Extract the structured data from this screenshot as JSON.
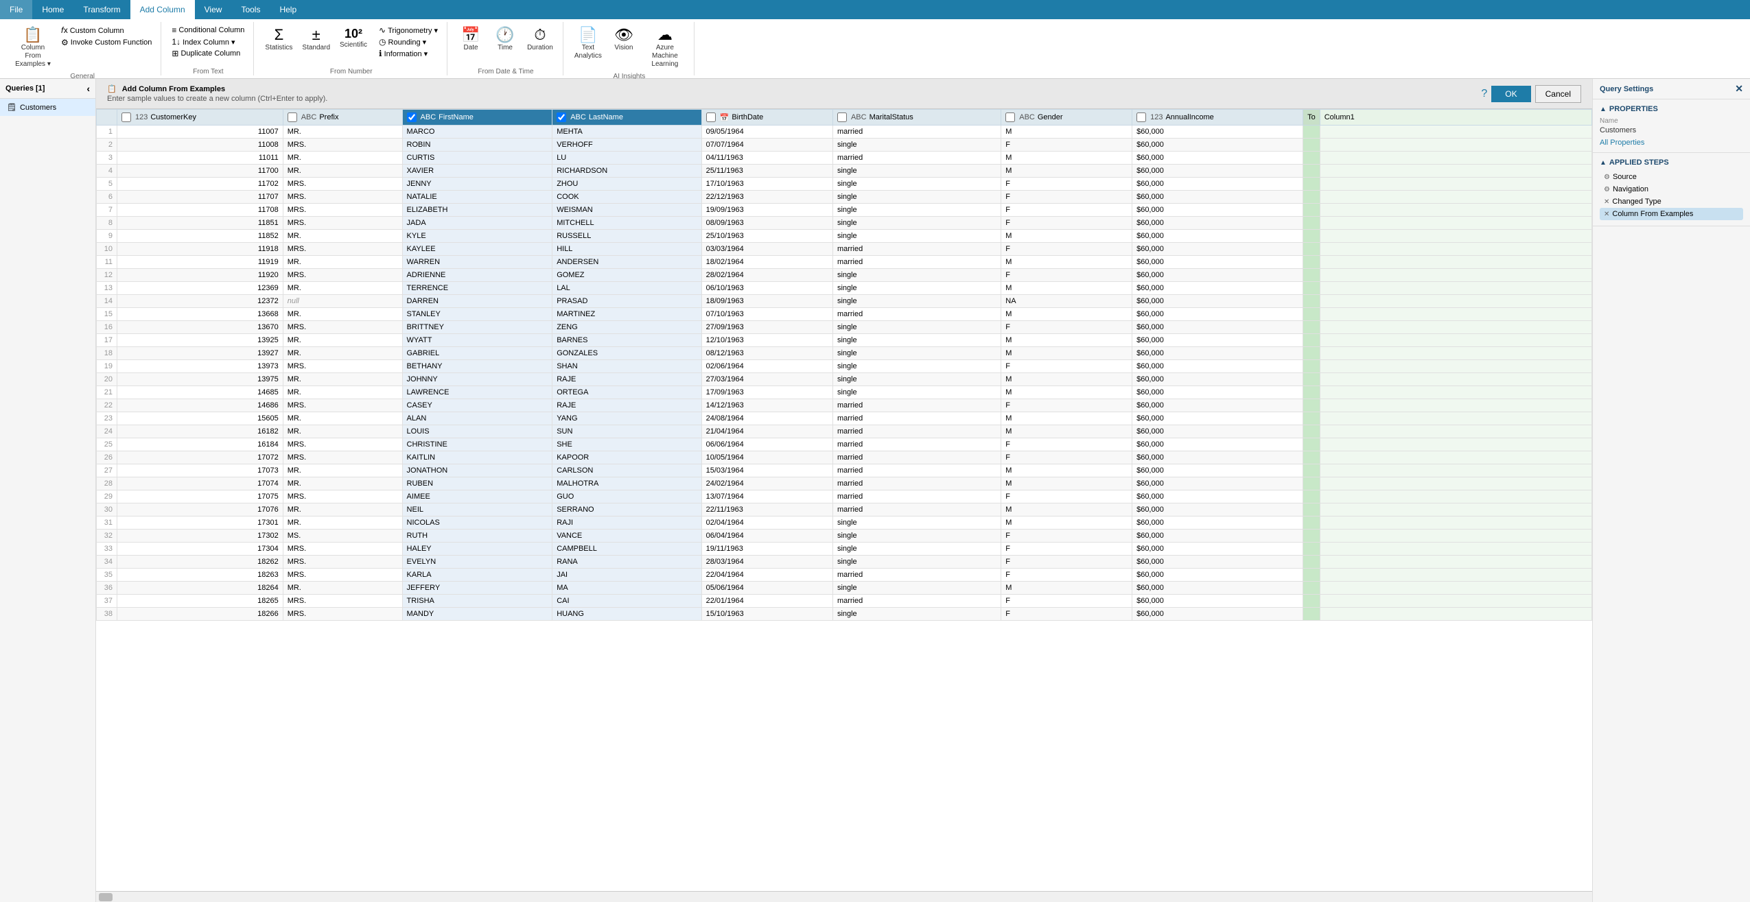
{
  "ribbon": {
    "tabs": [
      "File",
      "Home",
      "Transform",
      "Add Column",
      "View",
      "Tools",
      "Help"
    ],
    "active_tab": "Add Column",
    "groups": {
      "general": {
        "label": "General",
        "buttons": [
          {
            "id": "column-from-examples",
            "icon": "📋",
            "label": "Column From\nExamples ▾"
          },
          {
            "id": "custom-column",
            "icon": "fx",
            "label": "Custom\nColumn"
          },
          {
            "id": "invoke-custom-function",
            "icon": "⚙",
            "label": "Invoke Custom\nFunction"
          }
        ]
      },
      "from_text": {
        "label": "From Text",
        "items": [
          {
            "id": "conditional-column",
            "icon": "≡",
            "label": "Conditional Column"
          },
          {
            "id": "index-column",
            "icon": "1↓",
            "label": "Index Column ▾"
          },
          {
            "id": "duplicate-column",
            "icon": "⊞",
            "label": "Duplicate Column"
          }
        ]
      },
      "from_number": {
        "label": "From Number",
        "buttons": [
          {
            "id": "statistics",
            "icon": "Σ",
            "label": "Statistics"
          },
          {
            "id": "standard",
            "icon": "±",
            "label": "Standard"
          },
          {
            "id": "scientific",
            "icon": "10²",
            "label": "Scientific"
          },
          {
            "id": "trigonometry",
            "icon": "sin",
            "label": "Trigonometry ▾"
          },
          {
            "id": "rounding",
            "icon": "◷",
            "label": "Rounding ▾"
          },
          {
            "id": "information",
            "icon": "ℹ",
            "label": "Information ▾"
          }
        ]
      },
      "from_date_time": {
        "label": "From Date & Time",
        "buttons": [
          {
            "id": "date",
            "icon": "📅",
            "label": "Date"
          },
          {
            "id": "time",
            "icon": "🕐",
            "label": "Time"
          },
          {
            "id": "duration",
            "icon": "⏱",
            "label": "Duration"
          }
        ]
      },
      "text_analytics": {
        "label": "AI Insights",
        "buttons": [
          {
            "id": "text-analytics",
            "icon": "≡≡",
            "label": "Text\nAnalytics"
          },
          {
            "id": "vision",
            "icon": "👁",
            "label": "Vision"
          },
          {
            "id": "azure-ml",
            "icon": "☁",
            "label": "Azure Machine\nLearning"
          }
        ]
      }
    }
  },
  "left_panel": {
    "title": "Queries [1]",
    "queries": [
      {
        "id": "customers",
        "label": "Customers",
        "active": true
      }
    ]
  },
  "examples_bar": {
    "title": "Add Column From Examples",
    "subtitle": "Enter sample values to create a new column (Ctrl+Enter to apply).",
    "ok_label": "OK",
    "cancel_label": "Cancel"
  },
  "table": {
    "columns": [
      {
        "id": "row-num",
        "label": "",
        "type": "row-num",
        "selected": false
      },
      {
        "id": "customer-key",
        "label": "CustomerKey",
        "type": "123",
        "selected": false
      },
      {
        "id": "prefix",
        "label": "Prefix",
        "type": "ABC",
        "selected": false
      },
      {
        "id": "first-name",
        "label": "FirstName",
        "type": "ABC",
        "selected": true
      },
      {
        "id": "last-name",
        "label": "LastName",
        "type": "ABC",
        "selected": true
      },
      {
        "id": "birth-date",
        "label": "BirthDate",
        "type": "📅",
        "selected": false
      },
      {
        "id": "marital-status",
        "label": "MaritalStatus",
        "type": "ABC",
        "selected": false
      },
      {
        "id": "gender",
        "label": "Gender",
        "type": "ABC",
        "selected": false
      },
      {
        "id": "annual-income",
        "label": "AnnualIncome",
        "type": "123",
        "selected": false
      },
      {
        "id": "to-col",
        "label": "To",
        "type": "",
        "selected": false
      },
      {
        "id": "column1",
        "label": "Column1",
        "type": "",
        "selected": false
      }
    ],
    "rows": [
      {
        "row": 1,
        "customerKey": "11007",
        "prefix": "MR.",
        "firstName": "MARCO",
        "lastName": "MEHTA",
        "birthDate": "09/05/1964",
        "maritalStatus": "married",
        "gender": "M",
        "annualIncome": "$60,000",
        "to": "",
        "column1": ""
      },
      {
        "row": 2,
        "customerKey": "11008",
        "prefix": "MRS.",
        "firstName": "ROBIN",
        "lastName": "VERHOFF",
        "birthDate": "07/07/1964",
        "maritalStatus": "single",
        "gender": "F",
        "annualIncome": "$60,000",
        "to": "",
        "column1": ""
      },
      {
        "row": 3,
        "customerKey": "11011",
        "prefix": "MR.",
        "firstName": "CURTIS",
        "lastName": "LU",
        "birthDate": "04/11/1963",
        "maritalStatus": "married",
        "gender": "M",
        "annualIncome": "$60,000",
        "to": "",
        "column1": ""
      },
      {
        "row": 4,
        "customerKey": "11700",
        "prefix": "MR.",
        "firstName": "XAVIER",
        "lastName": "RICHARDSON",
        "birthDate": "25/11/1963",
        "maritalStatus": "single",
        "gender": "M",
        "annualIncome": "$60,000",
        "to": "",
        "column1": ""
      },
      {
        "row": 5,
        "customerKey": "11702",
        "prefix": "MRS.",
        "firstName": "JENNY",
        "lastName": "ZHOU",
        "birthDate": "17/10/1963",
        "maritalStatus": "single",
        "gender": "F",
        "annualIncome": "$60,000",
        "to": "",
        "column1": ""
      },
      {
        "row": 6,
        "customerKey": "11707",
        "prefix": "MRS.",
        "firstName": "NATALIE",
        "lastName": "COOK",
        "birthDate": "22/12/1963",
        "maritalStatus": "single",
        "gender": "F",
        "annualIncome": "$60,000",
        "to": "",
        "column1": ""
      },
      {
        "row": 7,
        "customerKey": "11708",
        "prefix": "MRS.",
        "firstName": "ELIZABETH",
        "lastName": "WEISMAN",
        "birthDate": "19/09/1963",
        "maritalStatus": "single",
        "gender": "F",
        "annualIncome": "$60,000",
        "to": "",
        "column1": ""
      },
      {
        "row": 8,
        "customerKey": "11851",
        "prefix": "MRS.",
        "firstName": "JADA",
        "lastName": "MITCHELL",
        "birthDate": "08/09/1963",
        "maritalStatus": "single",
        "gender": "F",
        "annualIncome": "$60,000",
        "to": "",
        "column1": ""
      },
      {
        "row": 9,
        "customerKey": "11852",
        "prefix": "MR.",
        "firstName": "KYLE",
        "lastName": "RUSSELL",
        "birthDate": "25/10/1963",
        "maritalStatus": "single",
        "gender": "M",
        "annualIncome": "$60,000",
        "to": "",
        "column1": ""
      },
      {
        "row": 10,
        "customerKey": "11918",
        "prefix": "MRS.",
        "firstName": "KAYLEE",
        "lastName": "HILL",
        "birthDate": "03/03/1964",
        "maritalStatus": "married",
        "gender": "F",
        "annualIncome": "$60,000",
        "to": "",
        "column1": ""
      },
      {
        "row": 11,
        "customerKey": "11919",
        "prefix": "MR.",
        "firstName": "WARREN",
        "lastName": "ANDERSEN",
        "birthDate": "18/02/1964",
        "maritalStatus": "married",
        "gender": "M",
        "annualIncome": "$60,000",
        "to": "",
        "column1": ""
      },
      {
        "row": 12,
        "customerKey": "11920",
        "prefix": "MRS.",
        "firstName": "ADRIENNE",
        "lastName": "GOMEZ",
        "birthDate": "28/02/1964",
        "maritalStatus": "single",
        "gender": "F",
        "annualIncome": "$60,000",
        "to": "",
        "column1": ""
      },
      {
        "row": 13,
        "customerKey": "12369",
        "prefix": "MR.",
        "firstName": "TERRENCE",
        "lastName": "LAL",
        "birthDate": "06/10/1963",
        "maritalStatus": "single",
        "gender": "M",
        "annualIncome": "$60,000",
        "to": "",
        "column1": ""
      },
      {
        "row": 14,
        "customerKey": "12372",
        "prefix": "null",
        "firstName": "DARREN",
        "lastName": "PRASAD",
        "birthDate": "18/09/1963",
        "maritalStatus": "single",
        "gender": "NA",
        "annualIncome": "$60,000",
        "to": "",
        "column1": ""
      },
      {
        "row": 15,
        "customerKey": "13668",
        "prefix": "MR.",
        "firstName": "STANLEY",
        "lastName": "MARTINEZ",
        "birthDate": "07/10/1963",
        "maritalStatus": "married",
        "gender": "M",
        "annualIncome": "$60,000",
        "to": "",
        "column1": ""
      },
      {
        "row": 16,
        "customerKey": "13670",
        "prefix": "MRS.",
        "firstName": "BRITTNEY",
        "lastName": "ZENG",
        "birthDate": "27/09/1963",
        "maritalStatus": "single",
        "gender": "F",
        "annualIncome": "$60,000",
        "to": "",
        "column1": ""
      },
      {
        "row": 17,
        "customerKey": "13925",
        "prefix": "MR.",
        "firstName": "WYATT",
        "lastName": "BARNES",
        "birthDate": "12/10/1963",
        "maritalStatus": "single",
        "gender": "M",
        "annualIncome": "$60,000",
        "to": "",
        "column1": ""
      },
      {
        "row": 18,
        "customerKey": "13927",
        "prefix": "MR.",
        "firstName": "GABRIEL",
        "lastName": "GONZALES",
        "birthDate": "08/12/1963",
        "maritalStatus": "single",
        "gender": "M",
        "annualIncome": "$60,000",
        "to": "",
        "column1": ""
      },
      {
        "row": 19,
        "customerKey": "13973",
        "prefix": "MRS.",
        "firstName": "BETHANY",
        "lastName": "SHAN",
        "birthDate": "02/06/1964",
        "maritalStatus": "single",
        "gender": "F",
        "annualIncome": "$60,000",
        "to": "",
        "column1": ""
      },
      {
        "row": 20,
        "customerKey": "13975",
        "prefix": "MR.",
        "firstName": "JOHNNY",
        "lastName": "RAJE",
        "birthDate": "27/03/1964",
        "maritalStatus": "single",
        "gender": "M",
        "annualIncome": "$60,000",
        "to": "",
        "column1": ""
      },
      {
        "row": 21,
        "customerKey": "14685",
        "prefix": "MR.",
        "firstName": "LAWRENCE",
        "lastName": "ORTEGA",
        "birthDate": "17/09/1963",
        "maritalStatus": "single",
        "gender": "M",
        "annualIncome": "$60,000",
        "to": "",
        "column1": ""
      },
      {
        "row": 22,
        "customerKey": "14686",
        "prefix": "MRS.",
        "firstName": "CASEY",
        "lastName": "RAJE",
        "birthDate": "14/12/1963",
        "maritalStatus": "married",
        "gender": "F",
        "annualIncome": "$60,000",
        "to": "",
        "column1": ""
      },
      {
        "row": 23,
        "customerKey": "15605",
        "prefix": "MR.",
        "firstName": "ALAN",
        "lastName": "YANG",
        "birthDate": "24/08/1964",
        "maritalStatus": "married",
        "gender": "M",
        "annualIncome": "$60,000",
        "to": "",
        "column1": ""
      },
      {
        "row": 24,
        "customerKey": "16182",
        "prefix": "MR.",
        "firstName": "LOUIS",
        "lastName": "SUN",
        "birthDate": "21/04/1964",
        "maritalStatus": "married",
        "gender": "M",
        "annualIncome": "$60,000",
        "to": "",
        "column1": ""
      },
      {
        "row": 25,
        "customerKey": "16184",
        "prefix": "MRS.",
        "firstName": "CHRISTINE",
        "lastName": "SHE",
        "birthDate": "06/06/1964",
        "maritalStatus": "married",
        "gender": "F",
        "annualIncome": "$60,000",
        "to": "",
        "column1": ""
      },
      {
        "row": 26,
        "customerKey": "17072",
        "prefix": "MRS.",
        "firstName": "KAITLIN",
        "lastName": "KAPOOR",
        "birthDate": "10/05/1964",
        "maritalStatus": "married",
        "gender": "F",
        "annualIncome": "$60,000",
        "to": "",
        "column1": ""
      },
      {
        "row": 27,
        "customerKey": "17073",
        "prefix": "MR.",
        "firstName": "JONATHON",
        "lastName": "CARLSON",
        "birthDate": "15/03/1964",
        "maritalStatus": "married",
        "gender": "M",
        "annualIncome": "$60,000",
        "to": "",
        "column1": ""
      },
      {
        "row": 28,
        "customerKey": "17074",
        "prefix": "MR.",
        "firstName": "RUBEN",
        "lastName": "MALHOTRA",
        "birthDate": "24/02/1964",
        "maritalStatus": "married",
        "gender": "M",
        "annualIncome": "$60,000",
        "to": "",
        "column1": ""
      },
      {
        "row": 29,
        "customerKey": "17075",
        "prefix": "MRS.",
        "firstName": "AIMEE",
        "lastName": "GUO",
        "birthDate": "13/07/1964",
        "maritalStatus": "married",
        "gender": "F",
        "annualIncome": "$60,000",
        "to": "",
        "column1": ""
      },
      {
        "row": 30,
        "customerKey": "17076",
        "prefix": "MR.",
        "firstName": "NEIL",
        "lastName": "SERRANO",
        "birthDate": "22/11/1963",
        "maritalStatus": "married",
        "gender": "M",
        "annualIncome": "$60,000",
        "to": "",
        "column1": ""
      },
      {
        "row": 31,
        "customerKey": "17301",
        "prefix": "MR.",
        "firstName": "NICOLAS",
        "lastName": "RAJI",
        "birthDate": "02/04/1964",
        "maritalStatus": "single",
        "gender": "M",
        "annualIncome": "$60,000",
        "to": "",
        "column1": ""
      },
      {
        "row": 32,
        "customerKey": "17302",
        "prefix": "MS.",
        "firstName": "RUTH",
        "lastName": "VANCE",
        "birthDate": "06/04/1964",
        "maritalStatus": "single",
        "gender": "F",
        "annualIncome": "$60,000",
        "to": "",
        "column1": ""
      },
      {
        "row": 33,
        "customerKey": "17304",
        "prefix": "MRS.",
        "firstName": "HALEY",
        "lastName": "CAMPBELL",
        "birthDate": "19/11/1963",
        "maritalStatus": "single",
        "gender": "F",
        "annualIncome": "$60,000",
        "to": "",
        "column1": ""
      },
      {
        "row": 34,
        "customerKey": "18262",
        "prefix": "MRS.",
        "firstName": "EVELYN",
        "lastName": "RANA",
        "birthDate": "28/03/1964",
        "maritalStatus": "single",
        "gender": "F",
        "annualIncome": "$60,000",
        "to": "",
        "column1": ""
      },
      {
        "row": 35,
        "customerKey": "18263",
        "prefix": "MRS.",
        "firstName": "KARLA",
        "lastName": "JAI",
        "birthDate": "22/04/1964",
        "maritalStatus": "married",
        "gender": "F",
        "annualIncome": "$60,000",
        "to": "",
        "column1": ""
      },
      {
        "row": 36,
        "customerKey": "18264",
        "prefix": "MR.",
        "firstName": "JEFFERY",
        "lastName": "MA",
        "birthDate": "05/06/1964",
        "maritalStatus": "single",
        "gender": "M",
        "annualIncome": "$60,000",
        "to": "",
        "column1": ""
      },
      {
        "row": 37,
        "customerKey": "18265",
        "prefix": "MRS.",
        "firstName": "TRISHA",
        "lastName": "CAI",
        "birthDate": "22/01/1964",
        "maritalStatus": "married",
        "gender": "F",
        "annualIncome": "$60,000",
        "to": "",
        "column1": ""
      },
      {
        "row": 38,
        "customerKey": "18266",
        "prefix": "MRS.",
        "firstName": "MANDY",
        "lastName": "HUANG",
        "birthDate": "15/10/1963",
        "maritalStatus": "single",
        "gender": "F",
        "annualIncome": "$60,000",
        "to": "",
        "column1": ""
      }
    ]
  },
  "right_panel": {
    "title": "Query Settings",
    "close_icon": "✕",
    "properties": {
      "section_title": "▲ PROPERTIES",
      "name_label": "Name",
      "name_value": "Customers",
      "all_properties_link": "All Properties"
    },
    "applied_steps": {
      "section_title": "▲ APPLIED STEPS",
      "steps": [
        {
          "id": "source",
          "label": "Source",
          "has_gear": true,
          "has_x": false,
          "active": false
        },
        {
          "id": "navigation",
          "label": "Navigation",
          "has_gear": true,
          "has_x": false,
          "active": false
        },
        {
          "id": "changed-type",
          "label": "Changed Type",
          "has_gear": false,
          "has_x": true,
          "active": false
        },
        {
          "id": "column-from-examples",
          "label": "× Column From Examples",
          "has_gear": false,
          "has_x": false,
          "active": true
        }
      ]
    }
  }
}
